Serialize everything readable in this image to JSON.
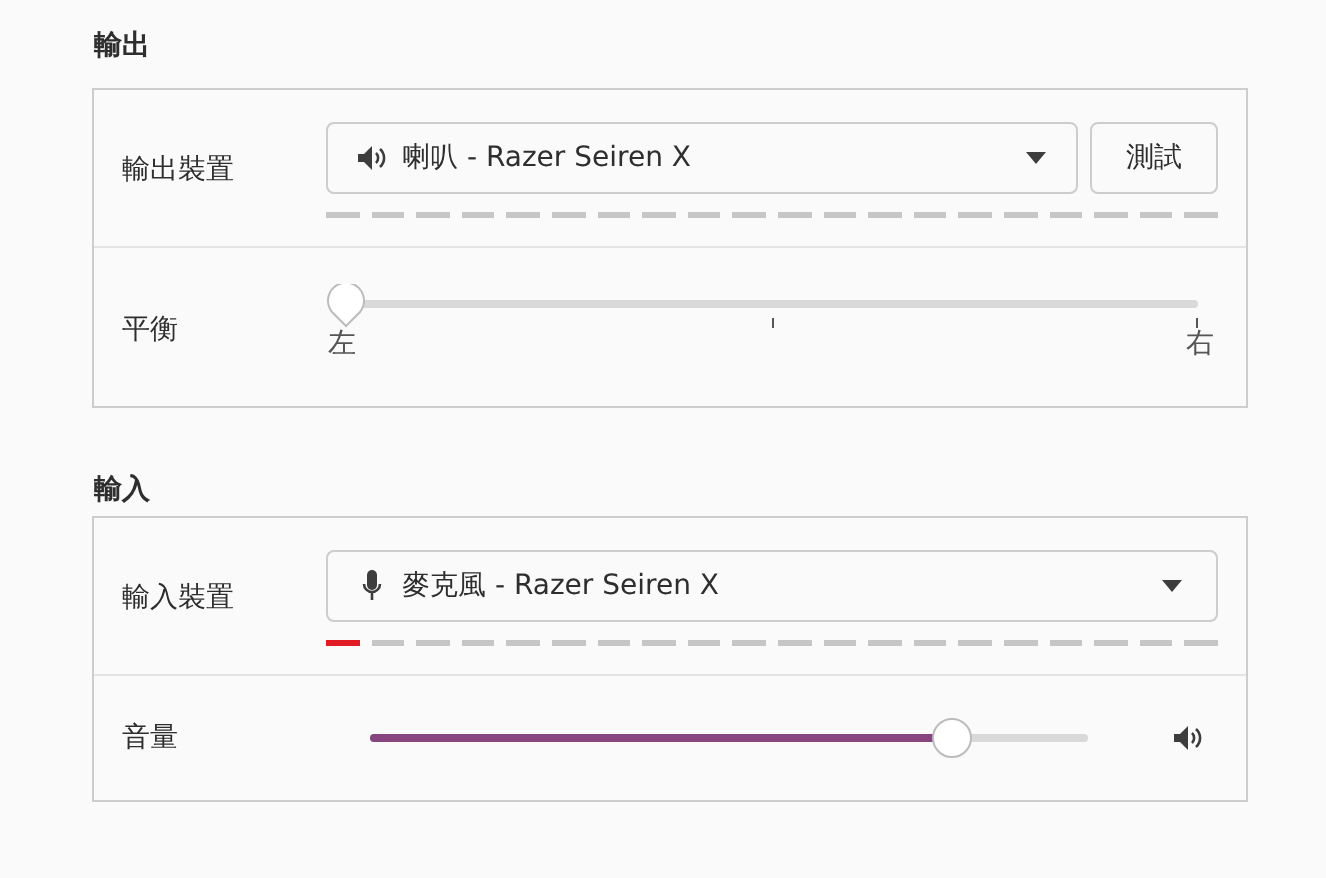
{
  "output": {
    "title": "輸出",
    "device": {
      "label": "輸出裝置",
      "value": "喇叭 - Razer Seiren X",
      "test_button": "測試"
    },
    "balance": {
      "label": "平衡",
      "level": 0,
      "left_mark": "左",
      "right_mark": "右"
    }
  },
  "input": {
    "title": "輸入",
    "device": {
      "label": "輸入裝置",
      "value": "麥克風 - Razer Seiren X",
      "level": 0.037
    },
    "volume": {
      "label": "音量",
      "level": 0.81
    }
  }
}
